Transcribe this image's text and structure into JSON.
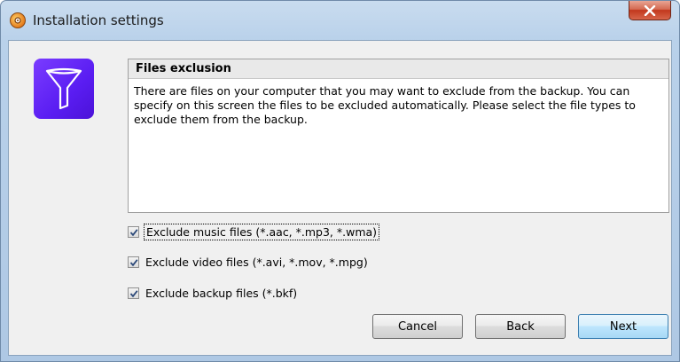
{
  "window": {
    "title": "Installation settings",
    "app_icon": "app-installer-icon",
    "close_icon": "close-icon"
  },
  "logo": {
    "icon": "funnel-icon",
    "color": "#5a1df2"
  },
  "panel": {
    "heading": "Files exclusion",
    "description": "There are files on your computer that you may want to exclude from the backup. You can specify on this screen the files to be excluded automatically. Please select the file types to exclude them from the backup."
  },
  "options": [
    {
      "label": "Exclude music files (*.aac, *.mp3, *.wma)",
      "checked": true,
      "focused": true
    },
    {
      "label": "Exclude video files (*.avi, *.mov, *.mpg)",
      "checked": true,
      "focused": false
    },
    {
      "label": "Exclude backup files (*.bkf)",
      "checked": true,
      "focused": false
    }
  ],
  "buttons": {
    "cancel": "Cancel",
    "back": "Back",
    "next": "Next"
  }
}
